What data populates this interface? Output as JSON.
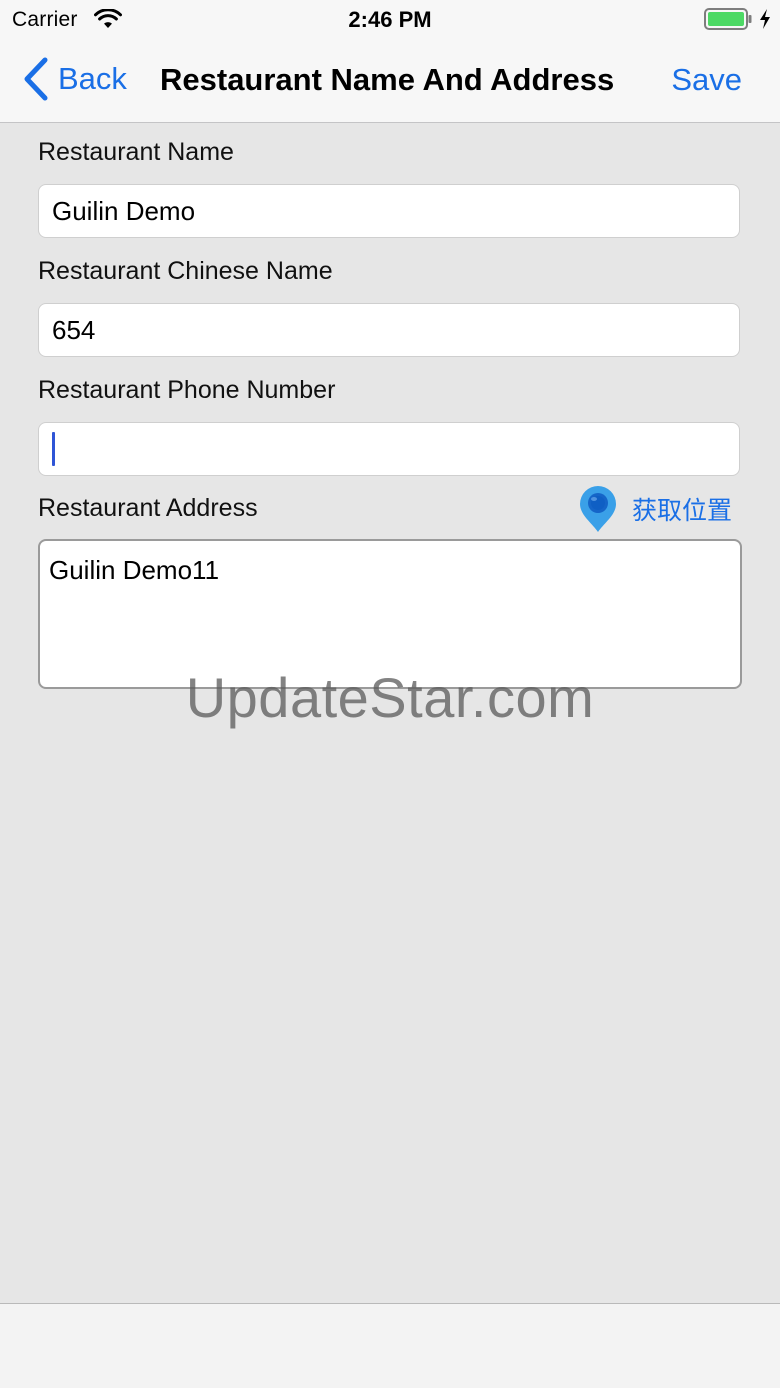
{
  "status_bar": {
    "carrier": "Carrier",
    "time": "2:46 PM",
    "icons": [
      "wifi-icon",
      "battery-icon",
      "charging-bolt-icon"
    ]
  },
  "nav": {
    "back_label": "Back",
    "title": "Restaurant Name And Address",
    "save_label": "Save"
  },
  "form": {
    "name": {
      "label": "Restaurant Name",
      "value": "Guilin Demo"
    },
    "chinese_name": {
      "label": "Restaurant Chinese Name",
      "value": "654"
    },
    "phone": {
      "label": "Restaurant Phone Number",
      "value": ""
    },
    "address": {
      "label": "Restaurant Address",
      "get_location_label": "获取位置",
      "value": "Guilin Demo11"
    }
  },
  "watermark": "UpdateStar.com",
  "colors": {
    "accent": "#1a6fe6",
    "background": "#e6e6e6",
    "bar": "#f7f7f7",
    "battery": "#4cd964",
    "pin": "#3aa0e8"
  }
}
